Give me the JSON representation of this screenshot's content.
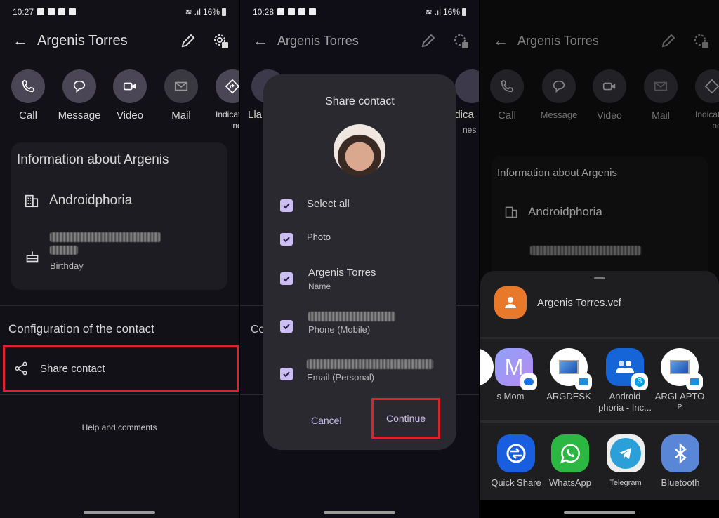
{
  "panel1": {
    "status": {
      "time": "10:27",
      "battery": "16%"
    },
    "header": {
      "title": "Argenis Torres"
    },
    "actions": [
      {
        "label": "Call",
        "icon": "phone-icon"
      },
      {
        "label": "Message",
        "icon": "message-icon"
      },
      {
        "label": "Video",
        "icon": "video-icon"
      },
      {
        "label": "Mail",
        "icon": "mail-icon"
      },
      {
        "label": "Indicates",
        "label2": "nes",
        "icon": "directions-icon"
      }
    ],
    "info": {
      "title": "Information about Argenis",
      "company": "Androidphoria",
      "birthday_label": "Birthday"
    },
    "config": {
      "title": "Configuration of the contact",
      "share": "Share contact"
    },
    "help": "Help and comments"
  },
  "panel2": {
    "status": {
      "time": "10:28",
      "battery": "16%"
    },
    "header": {
      "title": "Argenis Torres"
    },
    "bg_fragments": {
      "left_label": "Lla",
      "right_label": "idica",
      "right_label2": "nes",
      "config_fragment": "Co"
    },
    "dialog": {
      "title": "Share contact",
      "items": [
        {
          "main": "Select all",
          "sub": "",
          "checked": true
        },
        {
          "main": "Photo",
          "sub": "",
          "checked": true
        },
        {
          "main": "Argenis Torres",
          "sub": "Name",
          "checked": true
        },
        {
          "main": "",
          "sub": "Phone (Mobile)",
          "checked": true,
          "redacted": true
        },
        {
          "main": "",
          "sub": "Email (Personal)",
          "checked": true,
          "redacted": true
        }
      ],
      "cancel": "Cancel",
      "continue": "Continue"
    }
  },
  "panel3": {
    "header": {
      "title": "Argenis Torres"
    },
    "actions": [
      {
        "label": "Call"
      },
      {
        "label": "Message"
      },
      {
        "label": "Video"
      },
      {
        "label": "Mail"
      },
      {
        "label": "Indicates",
        "label2": "nes"
      }
    ],
    "info": {
      "title": "Information about Argenis",
      "company": "Androidphoria"
    },
    "sheet": {
      "file": "Argenis Torres.vcf",
      "direct": [
        {
          "name": "s"
        },
        {
          "name": "Mom"
        },
        {
          "name": "ARGDESK"
        },
        {
          "name": "Android",
          "name2": "phoria - Inc..."
        },
        {
          "name": "ARGLAPTO",
          "name2": "P"
        }
      ],
      "apps": [
        {
          "name": "Quick Share"
        },
        {
          "name": "WhatsApp"
        },
        {
          "name": "Telegram"
        },
        {
          "name": "Bluetooth"
        }
      ]
    }
  },
  "colors": {
    "highlight": "#e0202a",
    "checkbox": "#cdbdf5",
    "dialog_bg": "#2b2930",
    "accent_text": "#c9bff0"
  }
}
